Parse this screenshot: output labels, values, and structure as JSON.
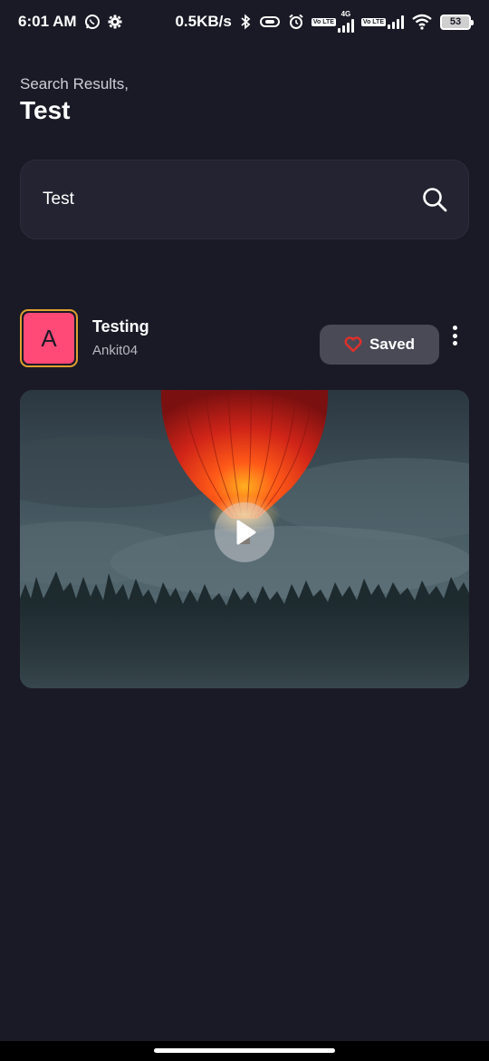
{
  "status_bar": {
    "time": "6:01 AM",
    "net_speed": "0.5KB/s",
    "network_type": "4G",
    "lte_label": "Vo LTE",
    "battery": "53",
    "icons": [
      "whatsapp-icon",
      "settings-icon",
      "bluetooth-icon",
      "vibrate-icon",
      "alarm-icon",
      "signal-icon",
      "wifi-icon",
      "battery-icon"
    ]
  },
  "header": {
    "caption": "Search Results,",
    "title": "Test"
  },
  "search": {
    "value": "Test",
    "icon": "search-icon"
  },
  "post": {
    "avatar_letter": "A",
    "title": "Testing",
    "author": "Ankit04",
    "saved_label": "Saved",
    "saved_icon": "heart-outline-icon",
    "more_icon": "more-vertical-icon",
    "play_icon": "play-icon"
  },
  "colors": {
    "background": "#1a1a26",
    "avatar_bg": "#ff4a78",
    "avatar_border": "#e0a030",
    "heart": "#e0302a",
    "saved_button": "#4a4a56"
  }
}
